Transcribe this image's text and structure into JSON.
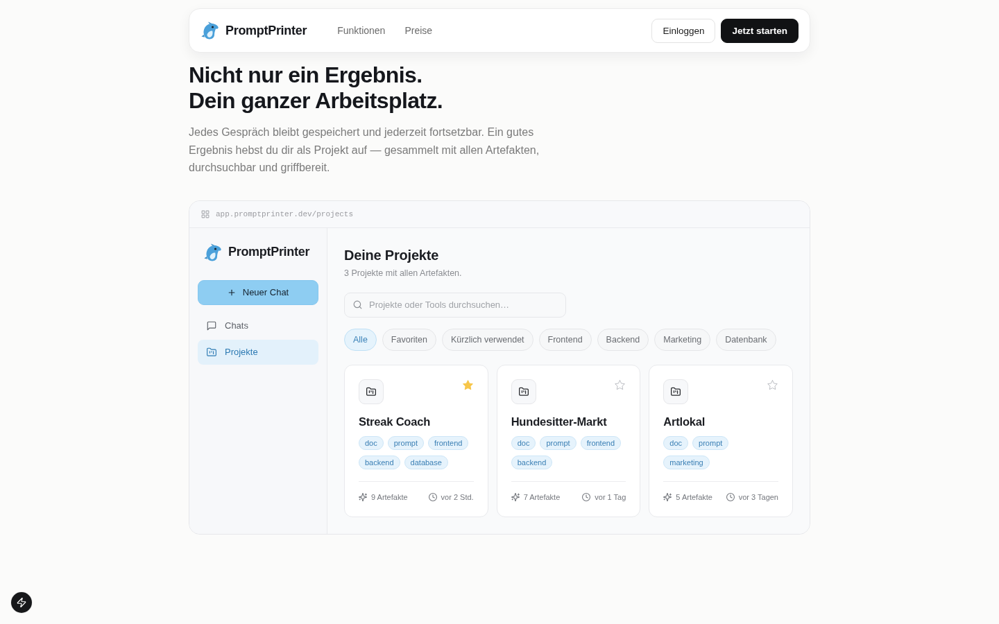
{
  "header": {
    "brand": "PromptPrinter",
    "nav": [
      "Funktionen",
      "Preise"
    ],
    "buttons": [
      {
        "label": "Einloggen",
        "kind": "secondary"
      },
      {
        "label": "Jetzt starten",
        "kind": "primary"
      }
    ]
  },
  "hero": {
    "headline": [
      "Nicht nur ein Ergebnis.",
      "Dein ganzer Arbeitsplatz."
    ],
    "text": "Jedes Gespräch bleibt gespeichert und jederzeit fortsetzbar. Ein gutes Ergebnis hebst du dir als Projekt auf — gesammelt mit allen Artefakten, durchsuchbar und griffbereit."
  },
  "app_preview": {
    "address": "app.promptprinter.dev/projects",
    "sidebar": {
      "brand": "PromptPrinter",
      "new_chat": "Neuer Chat",
      "items": [
        {
          "label": "Chats",
          "kind": "chat",
          "selected": false
        },
        {
          "label": "Projekte",
          "kind": "folder",
          "selected": true
        }
      ]
    },
    "main": {
      "title": "Deine Projekte",
      "subtitle": "3 Projekte mit allen Artefakten.",
      "search": {
        "placeholder": "Projekte oder Tools durchsuchen…"
      },
      "filters": [
        {
          "label": "Alle",
          "selected": true
        },
        {
          "label": "Favoriten",
          "selected": false
        },
        {
          "label": "Kürzlich verwendet",
          "selected": false
        },
        {
          "label": "Frontend",
          "selected": false
        },
        {
          "label": "Backend",
          "selected": false
        },
        {
          "label": "Marketing",
          "selected": false
        },
        {
          "label": "Datenbank",
          "selected": false
        }
      ],
      "projects": [
        {
          "name": "Streak Coach",
          "favorite": true,
          "tags": [
            "doc",
            "prompt",
            "frontend",
            "backend",
            "database"
          ],
          "artifacts": "9 Artefakte",
          "updated": "vor 2 Std."
        },
        {
          "name": "Hundesitter-Markt",
          "favorite": false,
          "tags": [
            "doc",
            "prompt",
            "frontend",
            "backend"
          ],
          "artifacts": "7 Artefakte",
          "updated": "vor 1 Tag"
        },
        {
          "name": "Artlokal",
          "favorite": false,
          "tags": [
            "doc",
            "prompt",
            "marketing"
          ],
          "artifacts": "5 Artefakte",
          "updated": "vor 3 Tagen"
        }
      ]
    }
  }
}
